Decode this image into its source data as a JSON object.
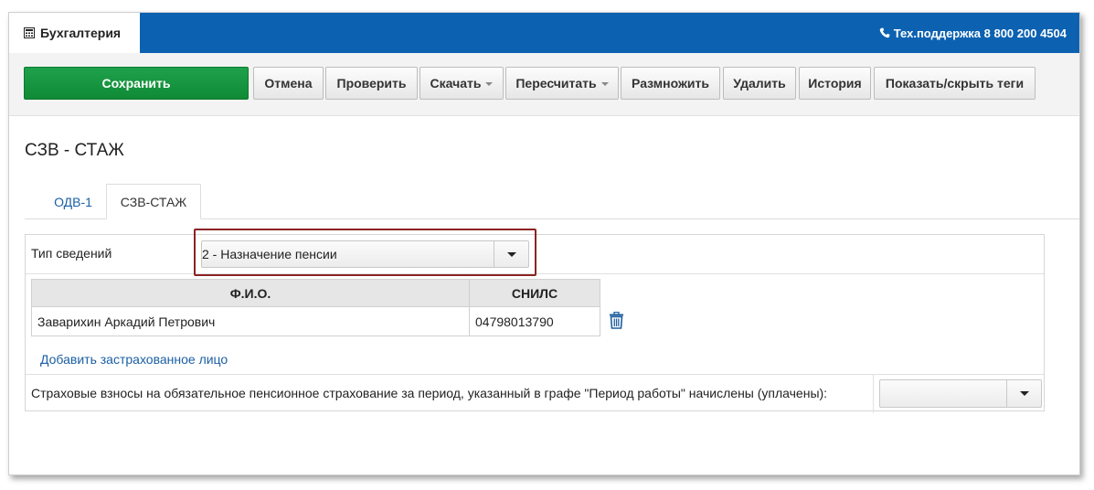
{
  "header": {
    "app_name": "Бухгалтерия",
    "support": "Тех.поддержка 8 800 200 4504",
    "colors": {
      "brand_blue": "#0c62b1",
      "save_green": "#159640",
      "highlight_border": "#8b2323",
      "link_blue": "#1a5fa3"
    }
  },
  "toolbar": {
    "save": "Сохранить",
    "cancel": "Отмена",
    "check": "Проверить",
    "download": "Скачать",
    "recalc": "Пересчитать",
    "multiply": "Размножить",
    "delete": "Удалить",
    "history": "История",
    "toggle_tags": "Показать/скрыть теги"
  },
  "page": {
    "title": "СЗВ - СТАЖ"
  },
  "tabs": [
    {
      "label": "ОДВ-1",
      "active": false
    },
    {
      "label": "СЗВ-СТАЖ",
      "active": true
    }
  ],
  "form": {
    "type_label": "Тип сведений",
    "type_value": "2 - Назначение пенсии",
    "table": {
      "headers": [
        "Ф.И.О.",
        "СНИЛС"
      ],
      "rows": [
        {
          "fio": "Заварихин Аркадий Петрович",
          "snils": "04798013790"
        }
      ]
    },
    "add_link": "Добавить застрахованное лицо",
    "insurance_label": "Страховые взносы на обязательное пенсионное страхование за период, указанный в графе \"Период работы\" начислены (уплачены):",
    "insurance_value": ""
  },
  "icons": [
    "calculator-icon",
    "phone-icon",
    "trash-icon",
    "chevron-down-icon"
  ]
}
